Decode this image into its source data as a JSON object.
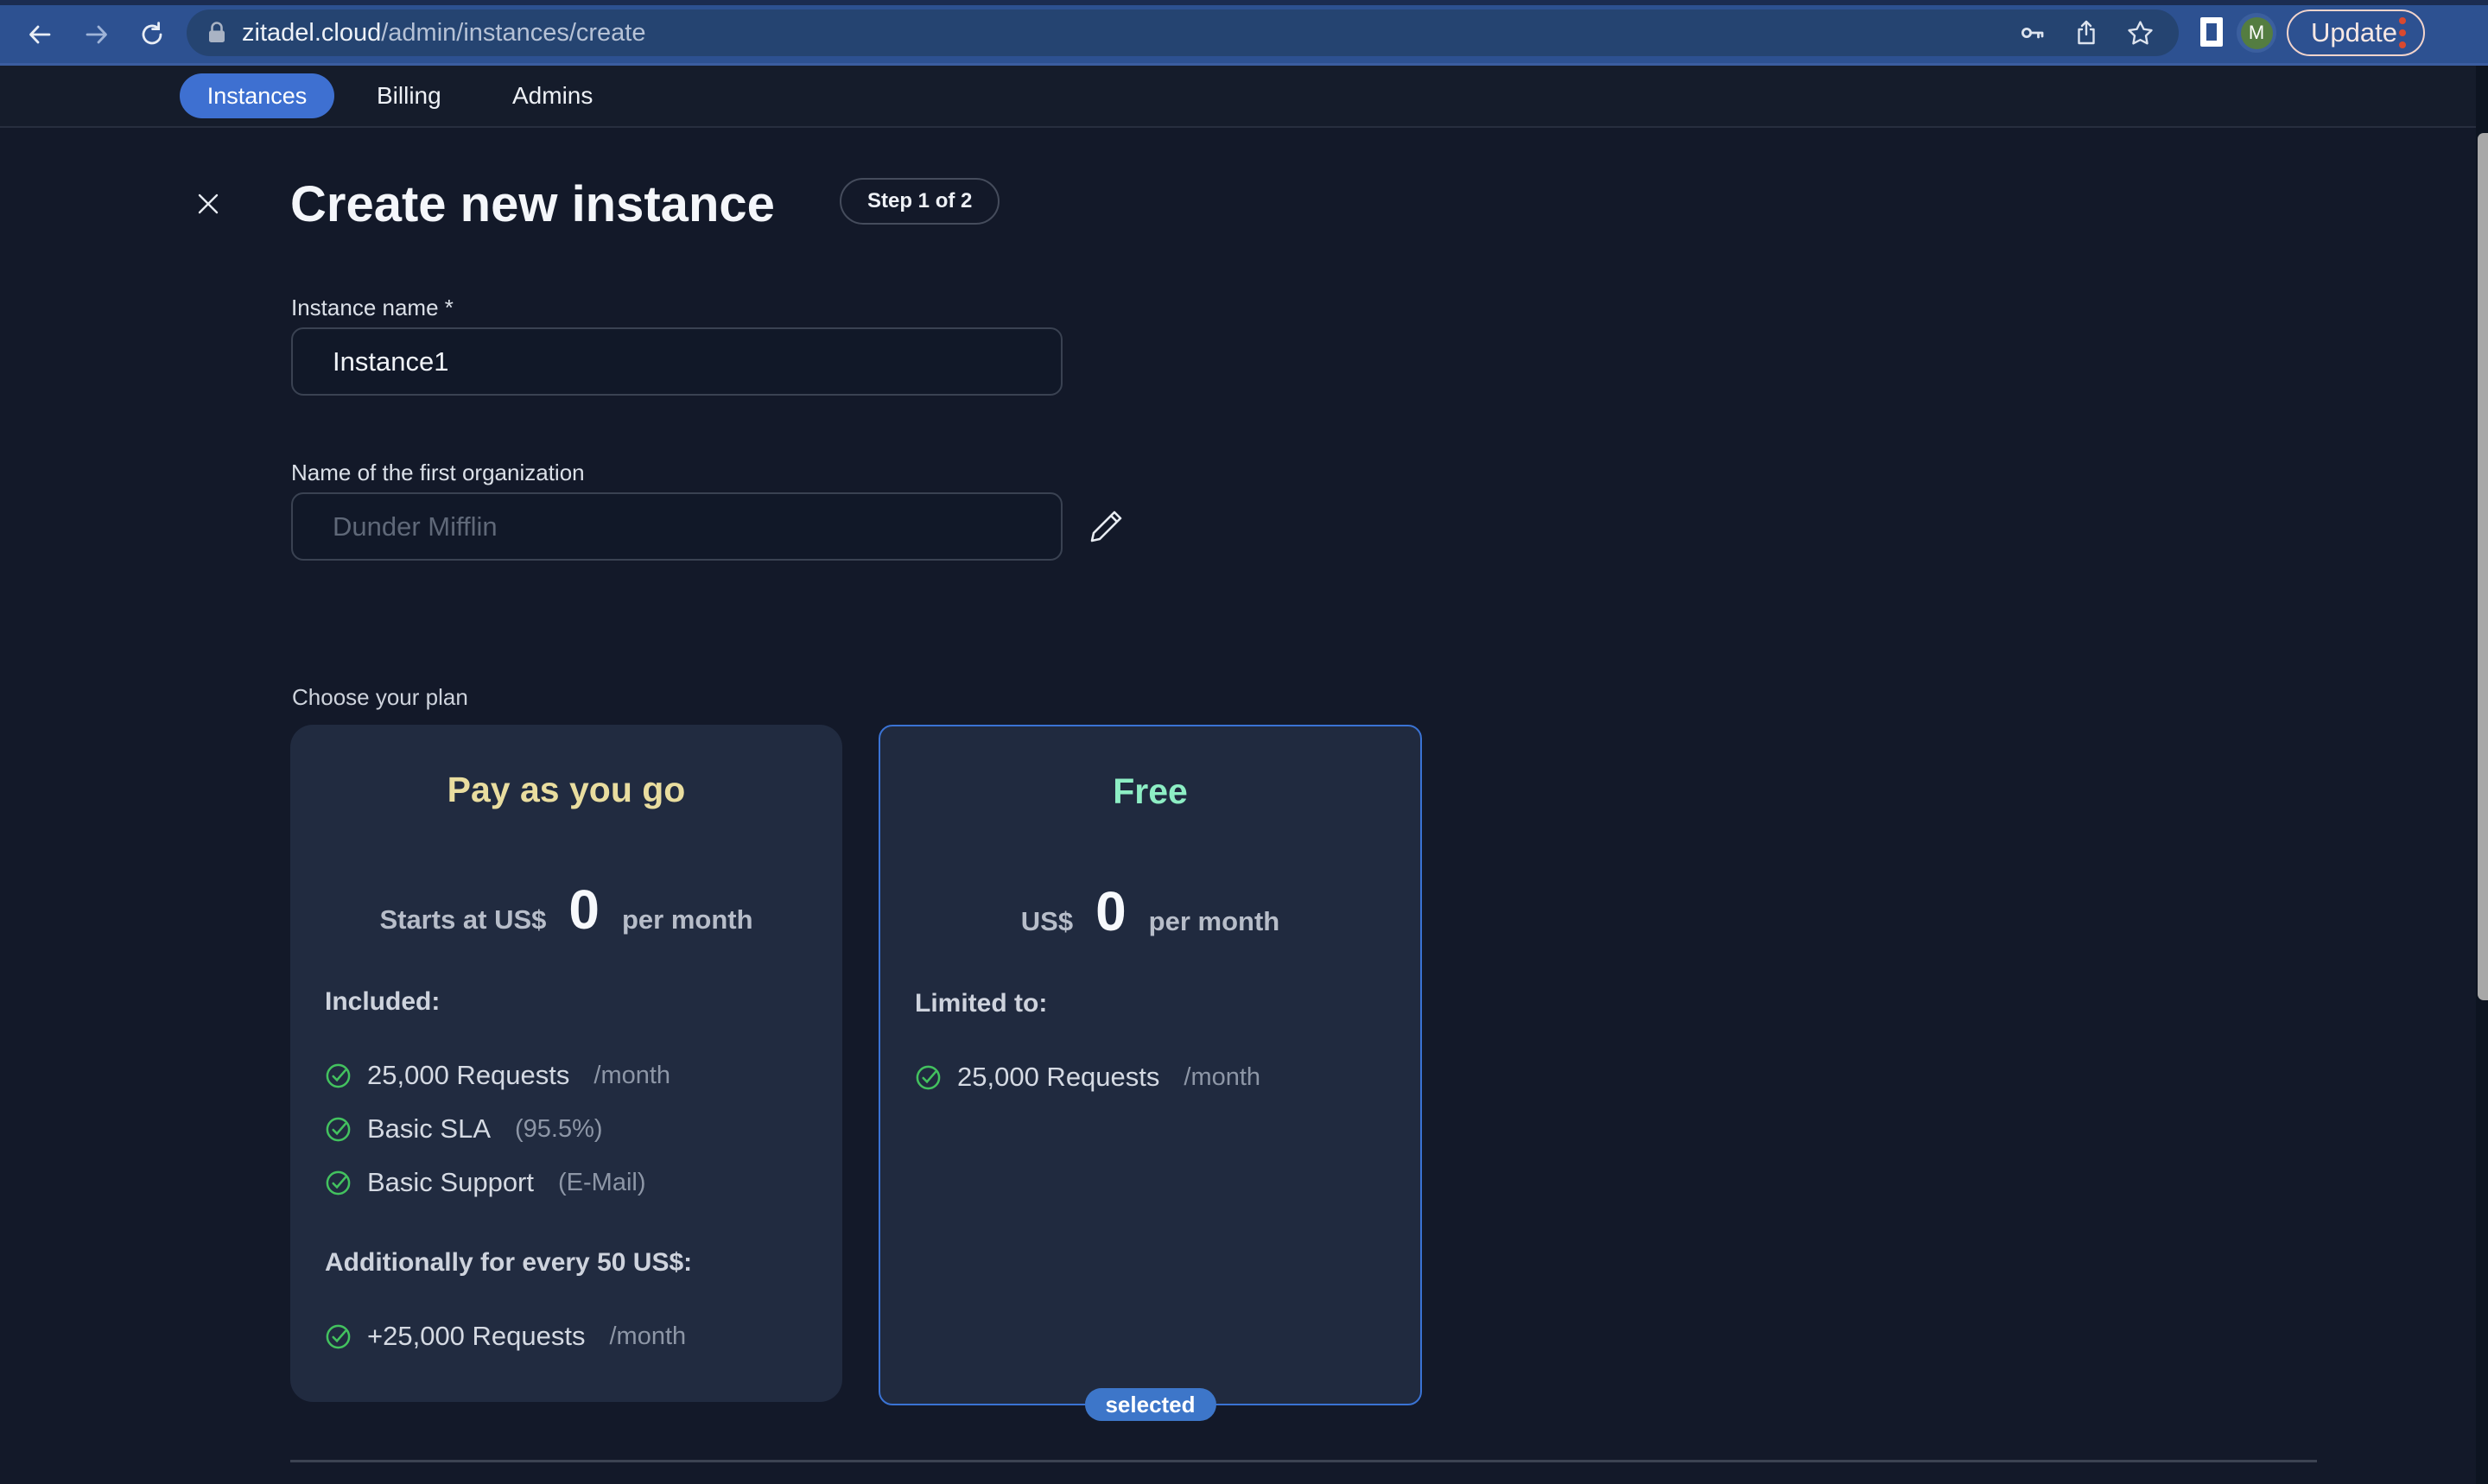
{
  "browser": {
    "url": {
      "host": "zitadel.cloud",
      "path": "/admin/instances/create"
    },
    "avatar_letter": "M",
    "update_button": "Update"
  },
  "nav": {
    "active_tab": "Instances",
    "tabs": [
      {
        "label": "Instances"
      },
      {
        "label": "Billing"
      },
      {
        "label": "Admins"
      }
    ]
  },
  "page": {
    "title": "Create new instance",
    "step_badge": "Step 1 of 2",
    "instance_name": {
      "label": "Instance name *",
      "value": "Instance1"
    },
    "organization": {
      "label": "Name of the first organization",
      "placeholder": "Dunder Mifflin"
    },
    "choose_plan_label": "Choose your plan",
    "plans": [
      {
        "name": "Pay as you go",
        "name_color": "#e9dd9f",
        "price_prefix": "Starts at US$",
        "price_value": "0",
        "price_suffix": "per month",
        "selected": false,
        "sections": [
          {
            "heading": "Included:",
            "items": [
              {
                "text": "25,000 Requests",
                "note": "/month"
              },
              {
                "text": "Basic SLA",
                "note": "(95.5%)"
              },
              {
                "text": "Basic Support",
                "note": "(E-Mail)"
              }
            ]
          },
          {
            "heading": "Additionally for every 50 US$:",
            "items": [
              {
                "text": "+25,000 Requests",
                "note": "/month"
              }
            ]
          }
        ]
      },
      {
        "name": "Free",
        "name_color": "#8deec4",
        "price_prefix": "US$",
        "price_value": "0",
        "price_suffix": "per month",
        "selected": true,
        "badge": "selected",
        "sections": [
          {
            "heading": "Limited to:",
            "items": [
              {
                "text": "25,000 Requests",
                "note": "/month"
              }
            ]
          }
        ]
      }
    ]
  },
  "colors": {
    "toolbar_blue": "#2d5191",
    "address_bar": "#254471",
    "accent_blue": "#3e70d1",
    "page_bg": "#131929",
    "card_bg": "#212b40",
    "selected_border": "#3a73d4",
    "check_green": "#43c25f",
    "payg_title": "#e9dd9f",
    "free_title": "#8deec4",
    "update_dots": "#d9492f",
    "avatar_green": "#547d41",
    "scrollbar": "#a8a8a8"
  },
  "icons": [
    "back-arrow-icon",
    "forward-arrow-icon",
    "reload-icon",
    "lock-icon",
    "key-icon",
    "share-icon",
    "star-icon",
    "side-panel-icon",
    "close-icon",
    "edit-pencil-icon",
    "check-circle-icon"
  ]
}
